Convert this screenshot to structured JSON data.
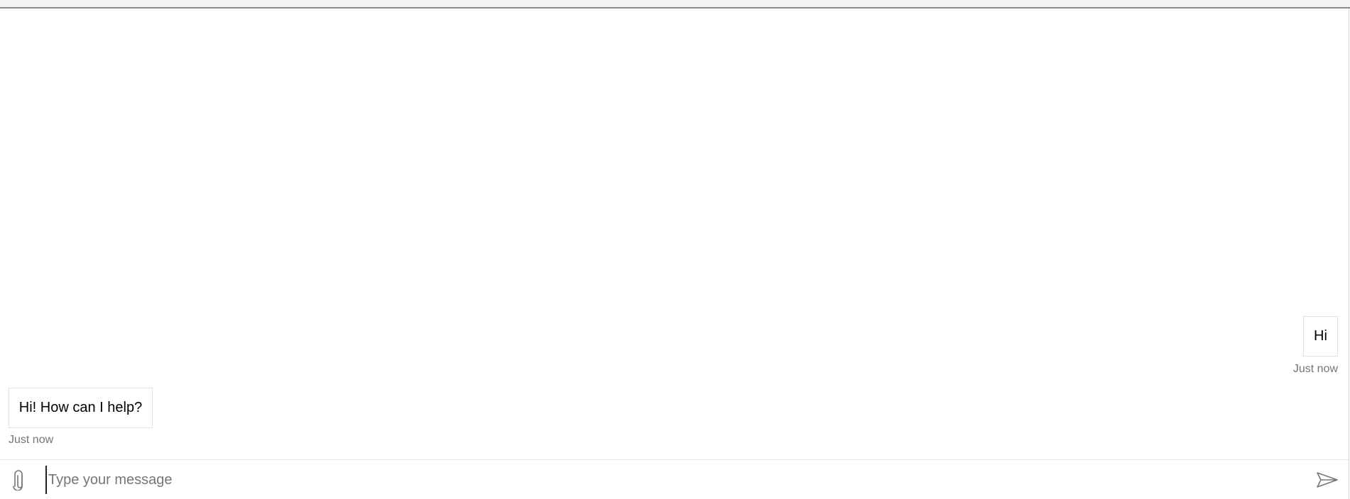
{
  "conversation": {
    "messages": [
      {
        "role": "user",
        "text": "Hi",
        "timestamp": "Just now"
      },
      {
        "role": "bot",
        "text": "Hi! How can I help?",
        "timestamp": "Just now"
      }
    ]
  },
  "composer": {
    "placeholder": "Type your message",
    "value": "",
    "attach_icon": "paperclip-icon",
    "send_icon": "send-icon"
  },
  "colors": {
    "timestamp": "#767676",
    "bubble_border": "#e1e1e1",
    "icon": "#767676"
  }
}
